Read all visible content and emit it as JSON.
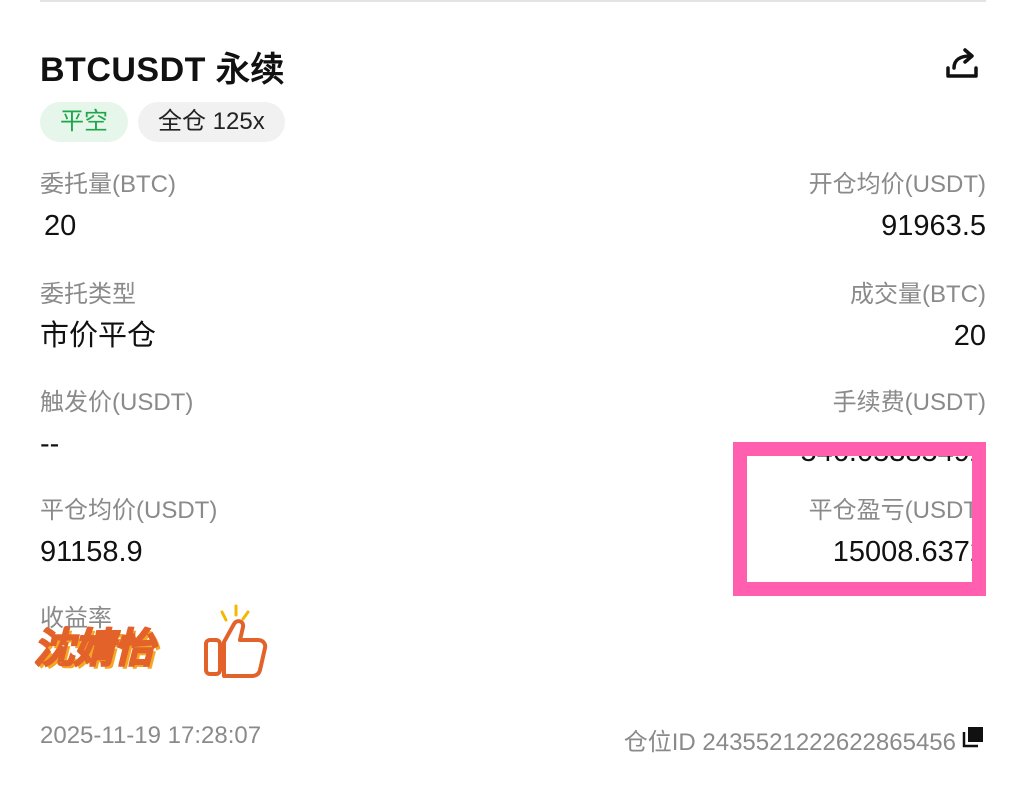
{
  "header": {
    "title": "BTCUSDT 永续",
    "share_icon": "share-icon"
  },
  "tags": {
    "side": "平空",
    "margin_leverage": "全仓 125x"
  },
  "fields": {
    "order_qty_label": "委托量(BTC)",
    "order_qty_value": "20",
    "open_avg_label": "开仓均价(USDT)",
    "open_avg_value": "91963.5",
    "order_type_label": "委托类型",
    "order_type_value": "市价平仓",
    "filled_qty_label": "成交量(BTC)",
    "filled_qty_value": "20",
    "trigger_label": "触发价(USDT)",
    "trigger_value": "--",
    "fee_label": "手续费(USDT)",
    "fee_value": "546.05385492",
    "close_avg_label": "平仓均价(USDT)",
    "close_avg_value": "91158.9",
    "pnl_label": "平仓盈亏(USDT)",
    "pnl_value": "15008.6372",
    "roi_label": "收益率"
  },
  "sticker": {
    "text": "沈婧怡",
    "icon": "thumbs-up-icon"
  },
  "footer": {
    "time": "2025-11-19 17:28:07",
    "position_id": "仓位ID 2435521222622865456",
    "copy_icon": "copy-icon"
  },
  "colors": {
    "green": "#1fa64a",
    "highlight": "#ff5fae",
    "label_gray": "#8a8a8a"
  }
}
